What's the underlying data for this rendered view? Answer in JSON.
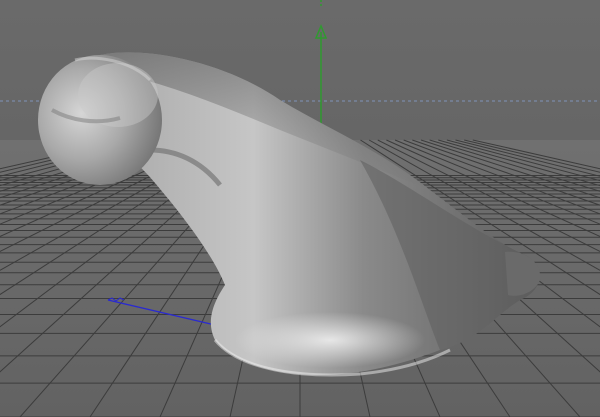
{
  "viewport": {
    "type": "perspective-3d-viewport",
    "background_color": "#696969",
    "sky_color": "#646464",
    "grid_color": "#3c3c3c",
    "horizon_line_color": "#8aa0c8",
    "axis_colors": {
      "y": "#2f9a2f",
      "z": "#2a2ad0"
    },
    "visible_axes": [
      "y-axis-arrow",
      "z-axis"
    ],
    "object": {
      "name": "sculpted-mesh",
      "shading": "smooth-gray",
      "base_color": "#9a9a9a"
    }
  }
}
